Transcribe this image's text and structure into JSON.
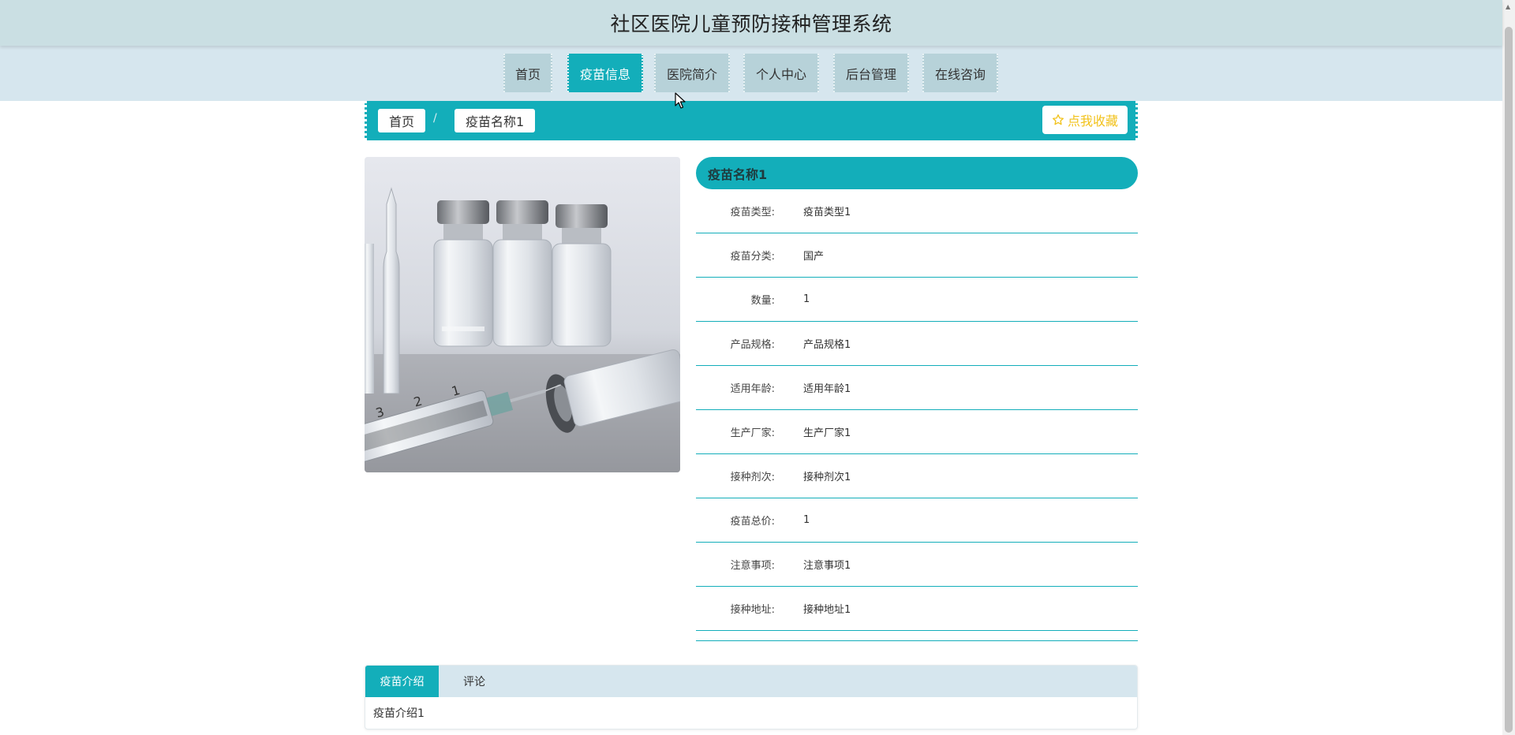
{
  "site": {
    "title": "社区医院儿童预防接种管理系统"
  },
  "nav": {
    "items": [
      {
        "label": "首页",
        "active": false
      },
      {
        "label": "疫苗信息",
        "active": true
      },
      {
        "label": "医院简介",
        "active": false
      },
      {
        "label": "个人中心",
        "active": false
      },
      {
        "label": "后台管理",
        "active": false
      },
      {
        "label": "在线咨询",
        "active": false
      }
    ]
  },
  "breadcrumb": {
    "home": "首页",
    "separator": "/",
    "current": "疫苗名称1",
    "favorite": "点我收藏"
  },
  "detail": {
    "title": "疫苗名称1",
    "rows": [
      {
        "label": "疫苗类型:",
        "value": "疫苗类型1"
      },
      {
        "label": "疫苗分类:",
        "value": "国产"
      },
      {
        "label": "数量:",
        "value": "1"
      },
      {
        "label": "产品规格:",
        "value": "产品规格1"
      },
      {
        "label": "适用年龄:",
        "value": "适用年龄1"
      },
      {
        "label": "生产厂家:",
        "value": "生产厂家1"
      },
      {
        "label": "接种剂次:",
        "value": "接种剂次1"
      },
      {
        "label": "疫苗总价:",
        "value": "1"
      },
      {
        "label": "注意事项:",
        "value": "注意事项1"
      },
      {
        "label": "接种地址:",
        "value": "接种地址1"
      }
    ]
  },
  "tabs": {
    "items": [
      {
        "label": "疫苗介绍",
        "active": true
      },
      {
        "label": "评论",
        "active": false
      }
    ],
    "content": "疫苗介绍1"
  },
  "colors": {
    "accent": "#13aeba",
    "header_bg": "#cadfe3",
    "nav_bg": "#d6e6ee",
    "nav_item_bg": "#b7d2d9",
    "favorite_text": "#f2c21b"
  },
  "icons": {
    "favorite": "star-outline-icon",
    "cursor": "mouse-pointer-icon"
  }
}
